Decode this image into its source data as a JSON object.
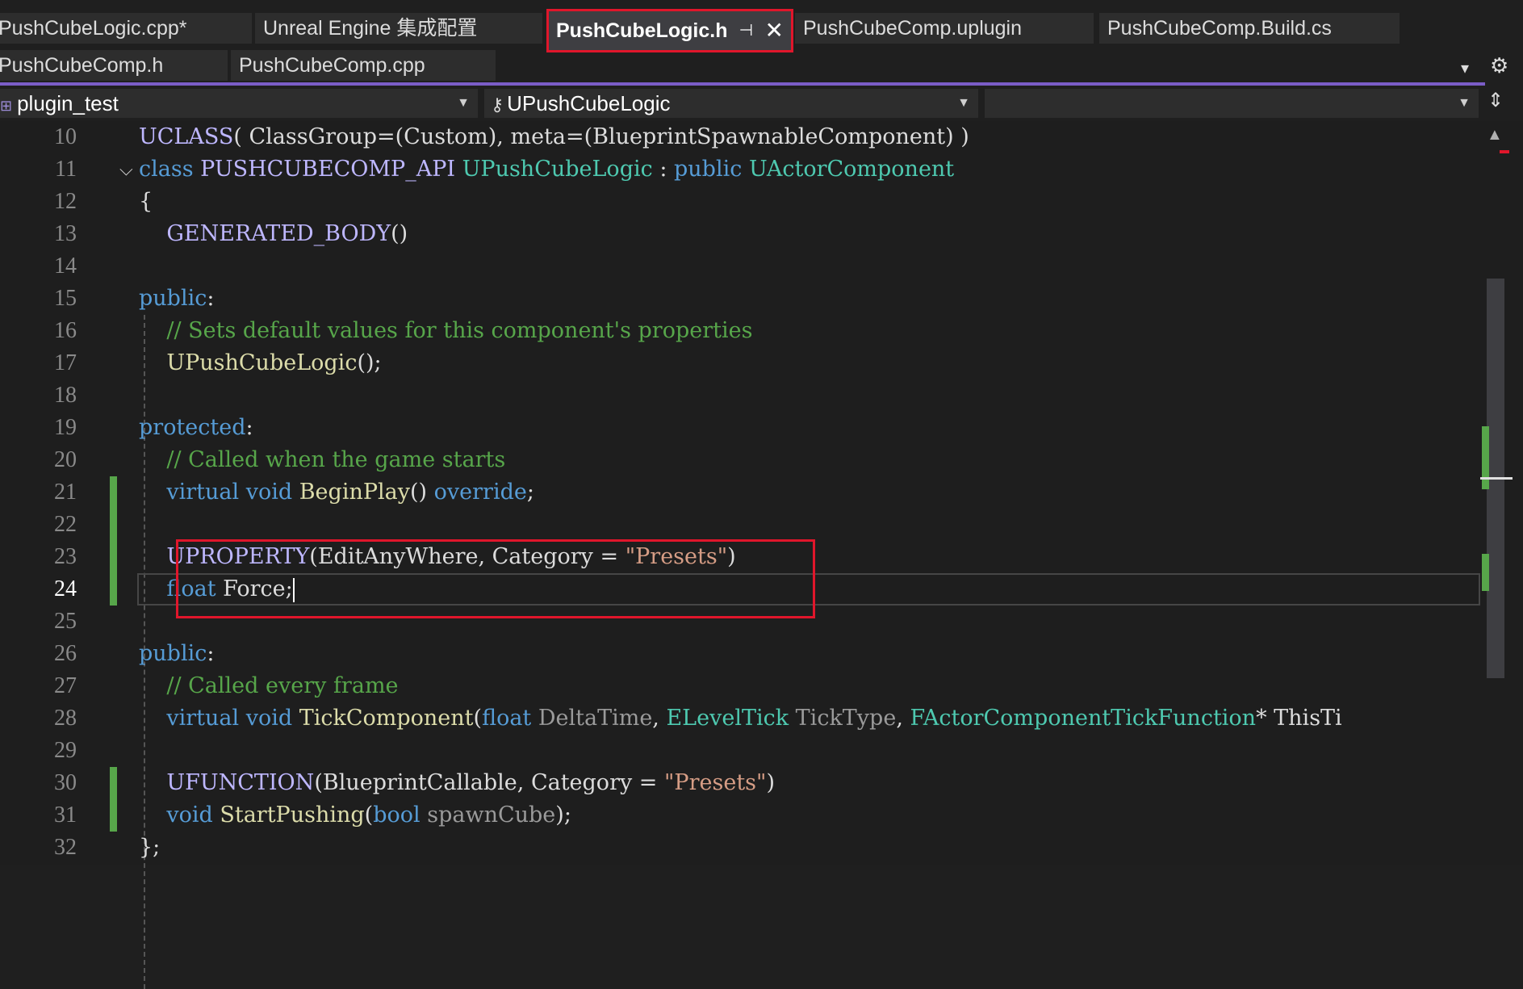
{
  "tabs_row1": [
    {
      "label": "PushCubeLogic.cpp*",
      "active": false
    },
    {
      "label": "Unreal Engine 集成配置",
      "active": false
    },
    {
      "label": "PushCubeLogic.h",
      "active": true,
      "pin_icon": "pin-icon",
      "close_icon": "close-icon"
    },
    {
      "label": "PushCubeComp.uplugin",
      "active": false
    },
    {
      "label": "PushCubeComp.Build.cs",
      "active": false
    }
  ],
  "tabs_row2": [
    {
      "label": "PushCubeComp.h"
    },
    {
      "label": "PushCubeComp.cpp"
    }
  ],
  "nav": {
    "project": "plugin_test",
    "class_scope": "UPushCubeLogic",
    "member_scope": ""
  },
  "colors": {
    "keyword": "#569cd6",
    "type": "#4ec9b0",
    "comment": "#57a64a",
    "string": "#d69d85",
    "macro": "#beb7ff",
    "highlight_box": "#e0162b",
    "accent": "#7b5dc7"
  },
  "code_lines": [
    {
      "n": "10",
      "parts": [
        [
          "mc",
          "UCLASS"
        ],
        [
          "",
          "( ClassGroup=(Custom), meta=(BlueprintSpawnableComponent) )"
        ]
      ]
    },
    {
      "n": "11",
      "parts": [
        [
          "kw",
          "class "
        ],
        [
          "mc",
          "PUSHCUBECOMP_API "
        ],
        [
          "ty",
          "UPushCubeLogic"
        ],
        [
          "",
          " : "
        ],
        [
          "kw",
          "public "
        ],
        [
          "ty",
          "UActorComponent"
        ]
      ]
    },
    {
      "n": "12",
      "parts": [
        [
          "",
          "{"
        ]
      ]
    },
    {
      "n": "13",
      "parts": [
        [
          "",
          "    "
        ],
        [
          "mc",
          "GENERATED_BODY"
        ],
        [
          "",
          "()"
        ]
      ]
    },
    {
      "n": "14",
      "parts": [
        [
          "",
          ""
        ]
      ]
    },
    {
      "n": "15",
      "parts": [
        [
          "kw",
          "public"
        ],
        [
          "",
          ":"
        ]
      ]
    },
    {
      "n": "16",
      "parts": [
        [
          "",
          "    "
        ],
        [
          "cm",
          "// Sets default values for this component's properties"
        ]
      ]
    },
    {
      "n": "17",
      "parts": [
        [
          "",
          "    "
        ],
        [
          "fn",
          "UPushCubeLogic"
        ],
        [
          "",
          "();"
        ]
      ]
    },
    {
      "n": "18",
      "parts": [
        [
          "",
          ""
        ]
      ]
    },
    {
      "n": "19",
      "parts": [
        [
          "kw",
          "protected"
        ],
        [
          "",
          ":"
        ]
      ]
    },
    {
      "n": "20",
      "parts": [
        [
          "",
          "    "
        ],
        [
          "cm",
          "// Called when the game starts"
        ]
      ]
    },
    {
      "n": "21",
      "parts": [
        [
          "",
          "    "
        ],
        [
          "kw",
          "virtual void "
        ],
        [
          "fn",
          "BeginPlay"
        ],
        [
          "",
          "() "
        ],
        [
          "kw",
          "override"
        ],
        [
          "",
          ";"
        ]
      ]
    },
    {
      "n": "22",
      "parts": [
        [
          "",
          ""
        ]
      ]
    },
    {
      "n": "23",
      "parts": [
        [
          "",
          "    "
        ],
        [
          "mc",
          "UPROPERTY"
        ],
        [
          "",
          "(EditAnyWhere, Category = "
        ],
        [
          "st",
          "\"Presets\""
        ],
        [
          "",
          ")"
        ]
      ]
    },
    {
      "n": "24",
      "parts": [
        [
          "",
          "    "
        ],
        [
          "kw",
          "float "
        ],
        [
          "",
          "Force;"
        ]
      ]
    },
    {
      "n": "25",
      "parts": [
        [
          "",
          ""
        ]
      ]
    },
    {
      "n": "26",
      "parts": [
        [
          "kw",
          "public"
        ],
        [
          "",
          ":"
        ]
      ]
    },
    {
      "n": "27",
      "parts": [
        [
          "",
          "    "
        ],
        [
          "cm",
          "// Called every frame"
        ]
      ]
    },
    {
      "n": "28",
      "parts": [
        [
          "",
          "    "
        ],
        [
          "kw",
          "virtual void "
        ],
        [
          "fn",
          "TickComponent"
        ],
        [
          "",
          "("
        ],
        [
          "kw",
          "float "
        ],
        [
          "pm",
          "DeltaTime"
        ],
        [
          "",
          ", "
        ],
        [
          "ty",
          "ELevelTick "
        ],
        [
          "pm",
          "TickType"
        ],
        [
          "",
          ", "
        ],
        [
          "ty",
          "FActorComponentTickFunction"
        ],
        [
          "",
          "* ThisTi"
        ]
      ]
    },
    {
      "n": "29",
      "parts": [
        [
          "",
          ""
        ]
      ]
    },
    {
      "n": "30",
      "parts": [
        [
          "",
          "    "
        ],
        [
          "mc",
          "UFUNCTION"
        ],
        [
          "",
          "(BlueprintCallable, Category = "
        ],
        [
          "st",
          "\"Presets\""
        ],
        [
          "",
          ")"
        ]
      ]
    },
    {
      "n": "31",
      "parts": [
        [
          "",
          "    "
        ],
        [
          "kw",
          "void "
        ],
        [
          "fn",
          "StartPushing"
        ],
        [
          "",
          "("
        ],
        [
          "kw",
          "bool "
        ],
        [
          "pm",
          "spawnCube"
        ],
        [
          "",
          ");"
        ]
      ]
    },
    {
      "n": "32",
      "parts": [
        [
          "",
          "};"
        ]
      ]
    }
  ],
  "current_line": "24",
  "changed_lines": [
    "21",
    "22",
    "23",
    "24",
    "30",
    "31"
  ]
}
